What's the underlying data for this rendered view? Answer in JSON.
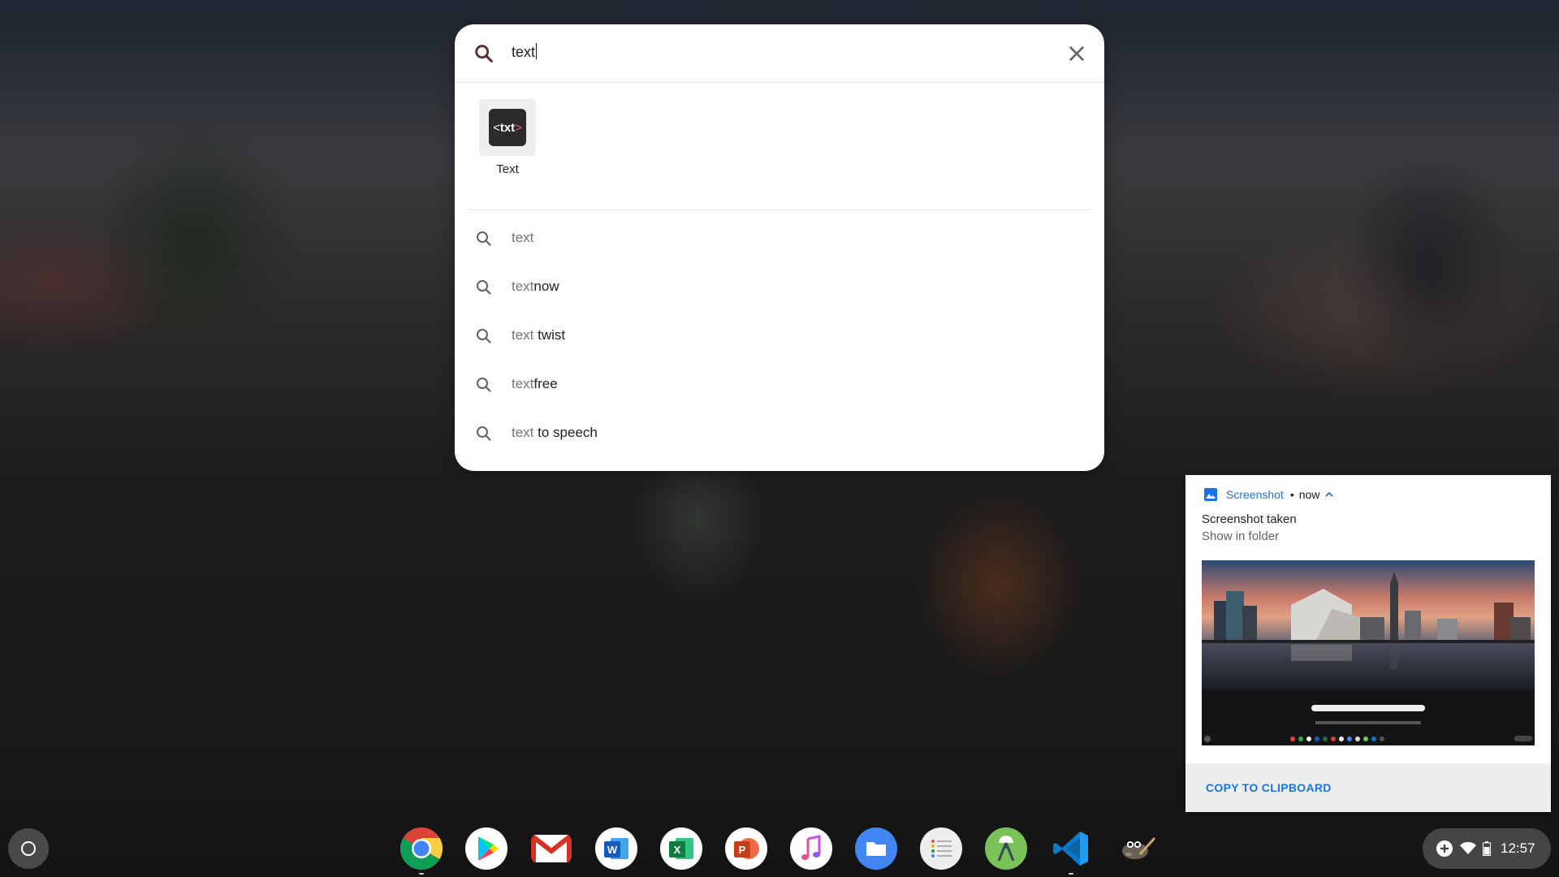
{
  "search": {
    "query": "text"
  },
  "app_results": [
    {
      "label": "Text",
      "icon": "text-app-icon"
    }
  ],
  "suggestions": [
    {
      "prefix": "text",
      "suffix": ""
    },
    {
      "prefix": "text",
      "suffix": "now"
    },
    {
      "prefix": "text",
      "suffix": " twist"
    },
    {
      "prefix": "text",
      "suffix": "free"
    },
    {
      "prefix": "text",
      "suffix": " to speech"
    }
  ],
  "notification": {
    "app": "Screenshot",
    "separator": "•",
    "time": "now",
    "title": "Screenshot taken",
    "message": "Show in folder",
    "action": "COPY TO CLIPBOARD"
  },
  "shelf": {
    "apps": [
      "chrome",
      "play-store",
      "gmail",
      "word",
      "excel",
      "powerpoint",
      "itunes",
      "files",
      "notes",
      "android-studio",
      "vscode",
      "gimp"
    ]
  },
  "tray": {
    "time": "12:57"
  },
  "colors": {
    "accent": "#1a73e8",
    "text_dim": "#70757a"
  }
}
